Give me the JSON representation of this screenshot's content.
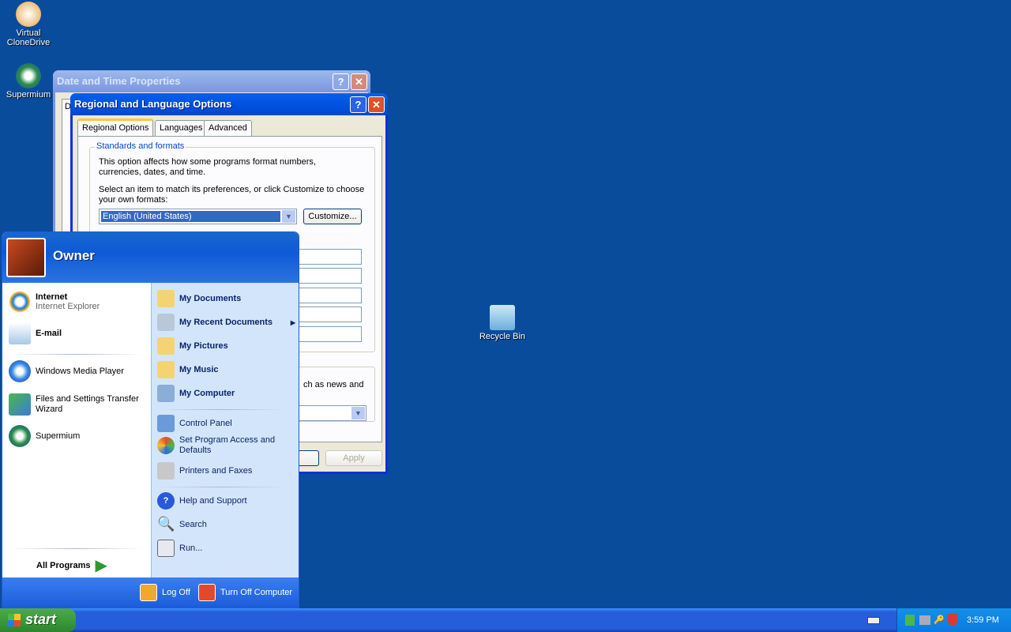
{
  "desktop": {
    "icons": [
      {
        "label": "Virtual CloneDrive"
      },
      {
        "label": "Supermium"
      },
      {
        "label": "Recycle Bin"
      }
    ]
  },
  "date_time_window": {
    "title": "Date and Time Properties",
    "tab_fragment": "D"
  },
  "regional_window": {
    "title": "Regional and Language Options",
    "tabs": [
      {
        "label": "Regional Options",
        "selected": true
      },
      {
        "label": "Languages"
      },
      {
        "label": "Advanced"
      }
    ],
    "group_title": "Standards and formats",
    "desc1": "This option affects how some programs format numbers, currencies, dates, and time.",
    "desc2": "Select an item to match its preferences, or click Customize to choose your own formats:",
    "format_value": "English (United States)",
    "customize_label": "Customize...",
    "location_text_fragment": "ch as news and",
    "apply_label": "Apply"
  },
  "start_menu": {
    "user": "Owner",
    "pinned": [
      {
        "title": "Internet",
        "subtitle": "Internet Explorer"
      },
      {
        "title": "E-mail"
      }
    ],
    "recent": [
      {
        "label": "Windows Media Player"
      },
      {
        "label": "Files and Settings Transfer Wizard"
      },
      {
        "label": "Supermium"
      }
    ],
    "all_programs": "All Programs",
    "right": [
      {
        "label": "My Documents"
      },
      {
        "label": "My Recent Documents"
      },
      {
        "label": "My Pictures"
      },
      {
        "label": "My Music"
      },
      {
        "label": "My Computer"
      },
      {
        "label": "Control Panel"
      },
      {
        "label": "Set Program Access and Defaults"
      },
      {
        "label": "Printers and Faxes"
      },
      {
        "label": "Help and Support"
      },
      {
        "label": "Search"
      },
      {
        "label": "Run..."
      }
    ],
    "log_off": "Log Off",
    "turn_off": "Turn Off Computer"
  },
  "taskbar": {
    "start_label": "start",
    "clock": "3:59 PM"
  },
  "colors": {
    "desktop": "#0a4c9c",
    "titlebar": "#0054e3",
    "start_green": "#3c9a3c"
  }
}
